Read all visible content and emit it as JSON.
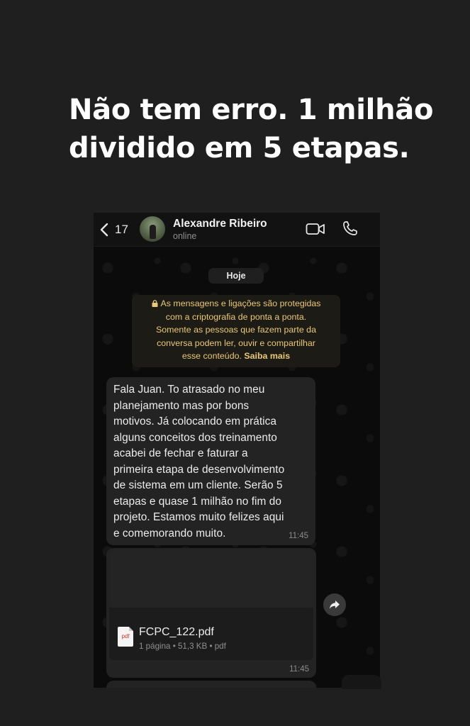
{
  "headline": {
    "line1": "Não tem erro.  1 milhão",
    "line2": "dividido em 5 etapas."
  },
  "header": {
    "back_count": "17",
    "contact_name": "Alexandre Ribeiro",
    "contact_status": "online",
    "icons": [
      "chevron-left-icon",
      "video-call-icon",
      "phone-call-icon"
    ]
  },
  "chat": {
    "date_label": "Hoje",
    "security_note": {
      "lines": [
        "As mensagens e ligações são protegidas",
        "com a criptografia de ponta a ponta.",
        "Somente as pessoas que fazem parte da",
        "conversa podem ler, ouvir e compartilhar",
        "esse conteúdo."
      ],
      "link": "Saiba mais"
    },
    "messages": [
      {
        "lines": [
          "Fala Juan. To atrasado no meu",
          "planejamento mas por bons",
          "motivos. Já colocando em prática",
          "alguns conceitos dos treinamento",
          "acabei de fechar e faturar a",
          "primeira etapa de desenvolvimento",
          "de sistema em um cliente.  Serão 5",
          "etapas e quase 1 milhão no fim do",
          "projeto. Estamos muito felizes aqui",
          "e comemorando muito."
        ],
        "time": "11:45"
      },
      {
        "document": {
          "icon_label": "pdf",
          "file_name": "FCPC_122.pdf",
          "meta": "1 página • 51,3 KB • pdf"
        },
        "time": "11:45"
      }
    ]
  },
  "colors": {
    "background": "#1f1f1f",
    "bubble": "#232323",
    "security_text": "#e9c877"
  }
}
